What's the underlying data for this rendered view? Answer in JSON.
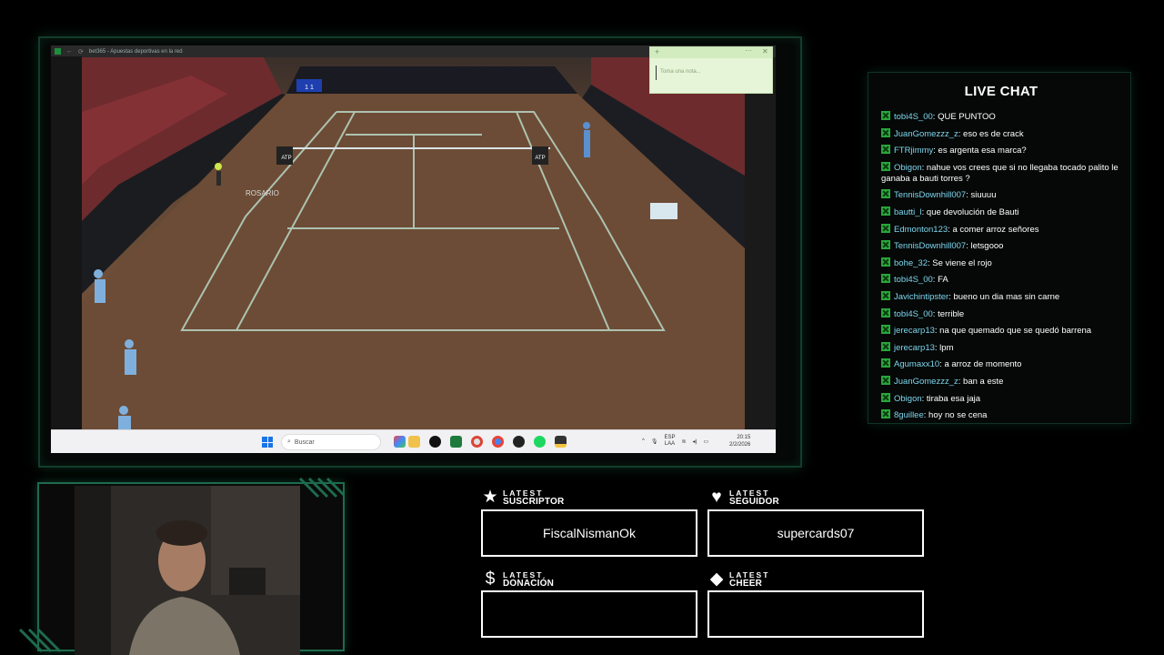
{
  "browser": {
    "tab_title": "bet365 - Apuestas deportivas en la red",
    "nav_back": "←",
    "nav_reload": "⟳"
  },
  "video": {
    "court_banner": "ROSARIO",
    "court_logos": [
      "ATP",
      "ATP"
    ],
    "scoreboard": "1 1"
  },
  "sticky_note": {
    "placeholder": "Toma una nota...",
    "add_label": "+",
    "menu_label": "···",
    "close_label": "✕"
  },
  "taskbar": {
    "search_placeholder": "Buscar",
    "tray_lang_top": "ESP",
    "tray_lang_bottom": "LAA",
    "clock_time": "20:15",
    "clock_date": "2/2/2026",
    "apps": [
      "copilot-icon",
      "file-explorer-icon",
      "tiktok-icon",
      "excel-icon",
      "chrome-icon",
      "whatsapp-icon",
      "obs-icon",
      "spotify-icon",
      "sticky-notes-icon"
    ]
  },
  "chat": {
    "title": "LIVE CHAT",
    "messages": [
      {
        "user": "tobi4S_00",
        "text": "QUE PUNTOO"
      },
      {
        "user": "JuanGomezzz_z",
        "text": "eso es de crack"
      },
      {
        "user": "FTRjimmy",
        "text": "es argenta esa marca?"
      },
      {
        "user": "Obigon",
        "text": "nahue vos crees que si no llegaba tocado palito le ganaba a bauti torres ?"
      },
      {
        "user": "TennisDownhill007",
        "text": "siuuuu"
      },
      {
        "user": "bautti_l",
        "text": "que devolución de Bauti"
      },
      {
        "user": "Edmonton123",
        "text": "a comer arroz señores"
      },
      {
        "user": "TennisDownhill007",
        "text": "letsgooo"
      },
      {
        "user": "bohe_32",
        "text": "Se viene el rojo"
      },
      {
        "user": "tobi4S_00",
        "text": "FA"
      },
      {
        "user": "Javichintipster",
        "text": "bueno un dia mas sin carne"
      },
      {
        "user": "tobi4S_00",
        "text": "terrible"
      },
      {
        "user": "jerecarp13",
        "text": "na que quemado que se quedó barrena"
      },
      {
        "user": "jerecarp13",
        "text": "lpm"
      },
      {
        "user": "Agumaxx10",
        "text": "a arroz de momento"
      },
      {
        "user": "JuanGomezzz_z",
        "text": "ban a este"
      },
      {
        "user": "Obigon",
        "text": "tiraba esa jaja"
      },
      {
        "user": "8guillee",
        "text": "hoy no se cena"
      }
    ]
  },
  "latest": {
    "suscriptor": {
      "top": "LATEST",
      "bottom": "SUSCRIPTOR",
      "icon": "star-icon",
      "value": "FiscalNismanOk"
    },
    "seguidor": {
      "top": "LATEST",
      "bottom": "SEGUIDOR",
      "icon": "heart-icon",
      "value": "supercards07"
    },
    "donacion": {
      "top": "LATEST",
      "bottom": "DONACIÓN",
      "icon": "dollar-icon",
      "value": ""
    },
    "cheer": {
      "top": "LATEST",
      "bottom": "CHEER",
      "icon": "diamond-icon",
      "value": ""
    }
  },
  "colors": {
    "frame_green": "#123d2b",
    "chat_user": "#7fd6ee",
    "chat_badge": "#2aa83b"
  }
}
